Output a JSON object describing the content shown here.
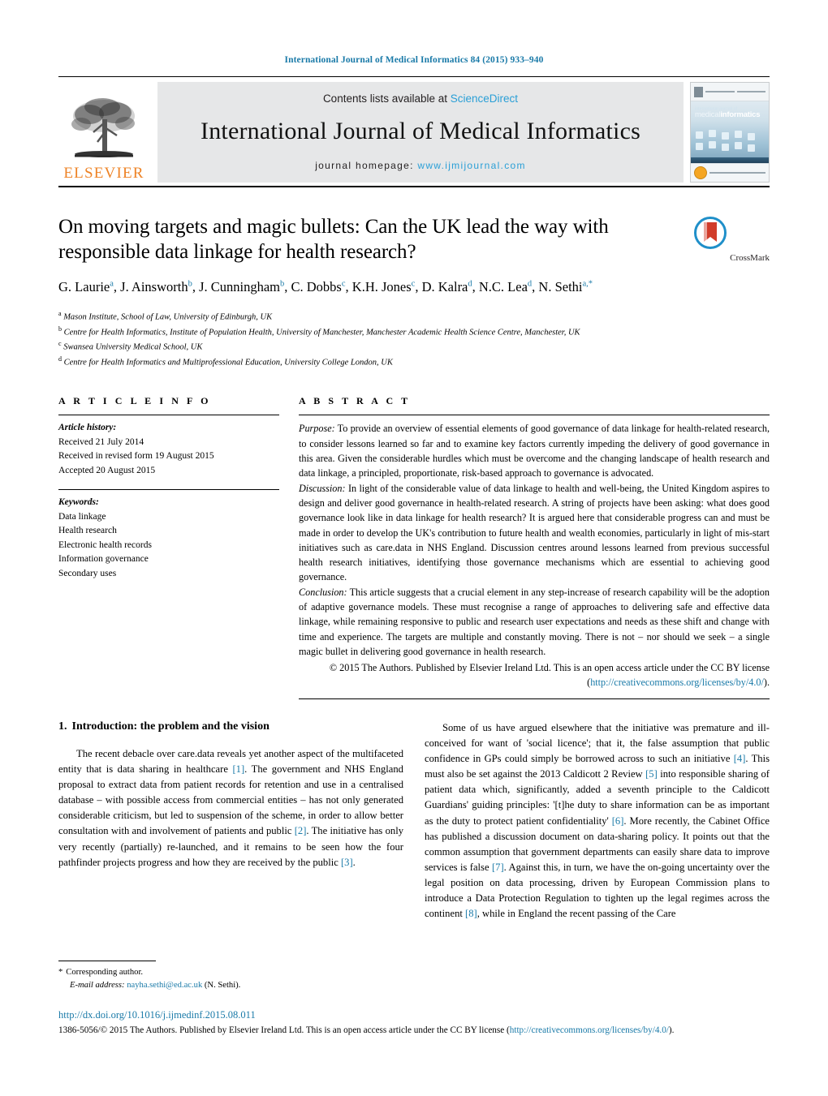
{
  "running_head": "International Journal of Medical Informatics 84 (2015) 933–940",
  "banner": {
    "publisher_name": "ELSEVIER",
    "contents_prefix": "Contents lists available at ",
    "contents_link": "ScienceDirect",
    "journal_title": "International Journal of Medical Informatics",
    "homepage_label": "journal homepage:",
    "homepage_url": "www.ijmijournal.com",
    "cover_title_small": "international journal of",
    "cover_title_a": "medical",
    "cover_title_b": "informatics"
  },
  "article": {
    "title": "On moving targets and magic bullets: Can the UK lead the way with responsible data linkage for health research?",
    "crossmark_label": "CrossMark",
    "authors": [
      {
        "name": "G. Laurie",
        "sup": "a",
        "sep": ", "
      },
      {
        "name": "J. Ainsworth",
        "sup": "b",
        "sep": ", "
      },
      {
        "name": "J. Cunningham",
        "sup": "b",
        "sep": ", "
      },
      {
        "name": "C. Dobbs",
        "sup": "c",
        "sep": ", "
      },
      {
        "name": "K.H. Jones",
        "sup": "c",
        "sep": ", "
      },
      {
        "name": "D. Kalra",
        "sup": "d",
        "sep": ", "
      },
      {
        "name": "N.C. Lea",
        "sup": "d",
        "sep": ", "
      },
      {
        "name": "N. Sethi",
        "sup": "a,*",
        "sep": ""
      }
    ],
    "affiliations": [
      {
        "marker": "a",
        "text": "Mason Institute, School of Law, University of Edinburgh, UK"
      },
      {
        "marker": "b",
        "text": "Centre for Health Informatics, Institute of Population Health, University of Manchester, Manchester Academic Health Science Centre, Manchester, UK"
      },
      {
        "marker": "c",
        "text": "Swansea University Medical School, UK"
      },
      {
        "marker": "d",
        "text": "Centre for Health Informatics and Multiprofessional Education, University College London, UK"
      }
    ]
  },
  "article_info": {
    "heading": "A R T I C L E   I N F O",
    "history_label": "Article history:",
    "history": [
      "Received 21 July 2014",
      "Received in revised form 19 August 2015",
      "Accepted 20 August 2015"
    ],
    "keywords_label": "Keywords:",
    "keywords": [
      "Data linkage",
      "Health research",
      "Electronic health records",
      "Information governance",
      "Secondary uses"
    ]
  },
  "abstract": {
    "heading": "A B S T R A C T",
    "purpose_label": "Purpose:",
    "purpose_text": " To provide an overview of essential elements of good governance of data linkage for health-related research, to consider lessons learned so far and to examine key factors currently impeding the delivery of good governance in this area. Given the considerable hurdles which must be overcome and the changing landscape of health research and data linkage, a principled, proportionate, risk-based approach to governance is advocated.",
    "discussion_label": "Discussion:",
    "discussion_text": " In light of the considerable value of data linkage to health and well-being, the United Kingdom aspires to design and deliver good governance in health-related research. A string of projects have been asking: what does good governance look like in data linkage for health research? It is argued here that considerable progress can and must be made in order to develop the UK's contribution to future health and wealth economies, particularly in light of mis-start initiatives such as care.data in NHS England. Discussion centres around lessons learned from previous successful health research initiatives, identifying those governance mechanisms which are essential to achieving good governance.",
    "conclusion_label": "Conclusion:",
    "conclusion_text": " This article suggests that a crucial element in any step-increase of research capability will be the adoption of adaptive governance models. These must recognise a range of approaches to delivering safe and effective data linkage, while remaining responsive to public and research user expectations and needs as these shift and change with time and experience. The targets are multiple and constantly moving. There is not – nor should we seek – a single magic bullet in delivering good governance in health research.",
    "copyright_text": "© 2015 The Authors. Published by Elsevier Ireland Ltd. This is an open access article under the CC BY license (",
    "copyright_link": "http://creativecommons.org/licenses/by/4.0/",
    "copyright_tail": ")."
  },
  "body": {
    "section_number": "1.",
    "section_title": "Introduction: the problem and the vision",
    "left_paragraph_parts": [
      {
        "t": "The recent debacle over care.data reveals yet another aspect of the multifaceted entity that is data sharing in healthcare "
      },
      {
        "t": "[1]",
        "ref": true
      },
      {
        "t": ". The government and NHS England proposal to extract data from patient records for retention and use in a centralised database – with possible access from commercial entities – has not only generated considerable criticism, but led to suspension of the scheme, in order to allow better consultation with and involvement of patients and public "
      },
      {
        "t": "[2]",
        "ref": true
      },
      {
        "t": ". The initiative has only very recently (partially) re-launched, and it remains to be seen how the four pathfinder projects progress and how they are received by the public "
      },
      {
        "t": "[3]",
        "ref": true
      },
      {
        "t": "."
      }
    ],
    "right_paragraph_parts": [
      {
        "t": "Some of us have argued elsewhere that the initiative was premature and ill-conceived for want of 'social licence'; that it, the false assumption that public confidence in GPs could simply be borrowed across to such an initiative "
      },
      {
        "t": "[4]",
        "ref": true
      },
      {
        "t": ". This must also be set against the 2013 Caldicott 2 Review "
      },
      {
        "t": "[5]",
        "ref": true
      },
      {
        "t": " into responsible sharing of patient data which, significantly, added a seventh principle to the Caldicott Guardians' guiding principles: '[t]he duty to share information can be as important as the duty to protect patient confidentiality' "
      },
      {
        "t": "[6]",
        "ref": true
      },
      {
        "t": ". More recently, the Cabinet Office has published a discussion document on data-sharing policy. It points out that the common assumption that government departments can easily share data to improve services is false "
      },
      {
        "t": "[7]",
        "ref": true
      },
      {
        "t": ". Against this, in turn, we have the on-going uncertainty over the legal position on data processing, driven by European Commission plans to introduce a Data Protection Regulation to tighten up the legal regimes across the continent "
      },
      {
        "t": "[8]",
        "ref": true
      },
      {
        "t": ", while in England the recent passing of the Care"
      }
    ]
  },
  "footnote": {
    "star": "*",
    "corresponding_label": "Corresponding author.",
    "email_label": "E-mail address:",
    "email": "nayha.sethi@ed.ac.uk",
    "email_attribution": "(N. Sethi)."
  },
  "footer": {
    "doi": "http://dx.doi.org/10.1016/j.ijmedinf.2015.08.011",
    "issn_prefix": "1386-5056/© 2015 The Authors. Published by Elsevier Ireland Ltd. This is an open access article under the CC BY license (",
    "issn_link": "http://creativecommons.org/licenses/by/4.0/",
    "issn_tail": ")."
  },
  "colors": {
    "link_blue": "#1a7aa8",
    "sciencedirect_blue": "#2a9fd6",
    "elsevier_orange": "#ee8326",
    "banner_grey": "#e6e7e8"
  }
}
